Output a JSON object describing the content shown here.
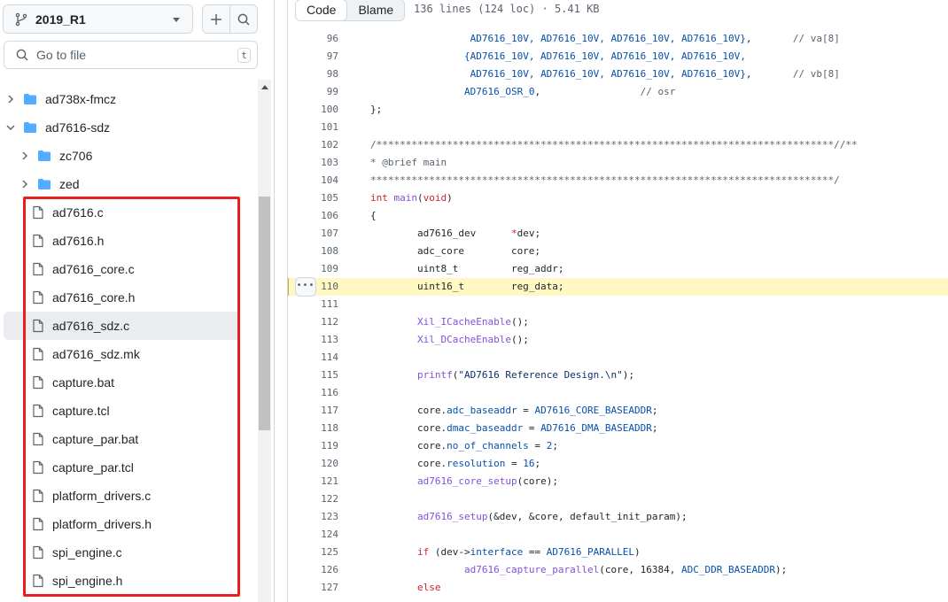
{
  "sidebar": {
    "branch": "2019_R1",
    "search_placeholder": "Go to file",
    "search_shortcut": "t",
    "tree": [
      {
        "label": "ad738x-fmcz",
        "type": "folder",
        "level": 0,
        "expanded": false
      },
      {
        "label": "ad7616-sdz",
        "type": "folder",
        "level": 0,
        "expanded": true
      },
      {
        "label": "zc706",
        "type": "folder",
        "level": 1,
        "expanded": false
      },
      {
        "label": "zed",
        "type": "folder",
        "level": 1,
        "expanded": false
      },
      {
        "label": "ad7616.c",
        "type": "file",
        "level": 1
      },
      {
        "label": "ad7616.h",
        "type": "file",
        "level": 1
      },
      {
        "label": "ad7616_core.c",
        "type": "file",
        "level": 1
      },
      {
        "label": "ad7616_core.h",
        "type": "file",
        "level": 1
      },
      {
        "label": "ad7616_sdz.c",
        "type": "file",
        "level": 1,
        "selected": true
      },
      {
        "label": "ad7616_sdz.mk",
        "type": "file",
        "level": 1
      },
      {
        "label": "capture.bat",
        "type": "file",
        "level": 1
      },
      {
        "label": "capture.tcl",
        "type": "file",
        "level": 1
      },
      {
        "label": "capture_par.bat",
        "type": "file",
        "level": 1
      },
      {
        "label": "capture_par.tcl",
        "type": "file",
        "level": 1
      },
      {
        "label": "platform_drivers.c",
        "type": "file",
        "level": 1
      },
      {
        "label": "platform_drivers.h",
        "type": "file",
        "level": 1
      },
      {
        "label": "spi_engine.c",
        "type": "file",
        "level": 1
      },
      {
        "label": "spi_engine.h",
        "type": "file",
        "level": 1
      }
    ]
  },
  "viewer": {
    "code_tab": "Code",
    "blame_tab": "Blame",
    "file_meta": "136 lines (124 loc) · 5.41 KB",
    "highlighted_line": "110",
    "lines": [
      {
        "num": "96",
        "tokens": [
          [
            "                 ",
            ""
          ],
          [
            "AD7616_10V, AD7616_10V, AD7616_10V, AD7616_10V}",
            "blue"
          ],
          [
            ",       ",
            ""
          ],
          [
            "// va[8]",
            "gray"
          ]
        ]
      },
      {
        "num": "97",
        "tokens": [
          [
            "                ",
            ""
          ],
          [
            "{AD7616_10V, AD7616_10V, AD7616_10V, AD7616_10V,",
            "blue"
          ]
        ]
      },
      {
        "num": "98",
        "tokens": [
          [
            "                 ",
            ""
          ],
          [
            "AD7616_10V, AD7616_10V, AD7616_10V, AD7616_10V}",
            "blue"
          ],
          [
            ",       ",
            ""
          ],
          [
            "// vb[8]",
            "gray"
          ]
        ]
      },
      {
        "num": "99",
        "tokens": [
          [
            "                ",
            ""
          ],
          [
            "AD7616_OSR_0",
            "blue"
          ],
          [
            ",                 ",
            ""
          ],
          [
            "// osr",
            "gray"
          ]
        ]
      },
      {
        "num": "100",
        "tokens": [
          [
            "};",
            ""
          ]
        ]
      },
      {
        "num": "101",
        "tokens": []
      },
      {
        "num": "102",
        "tokens": [
          [
            "/******************************************************************************//**",
            "gray"
          ]
        ]
      },
      {
        "num": "103",
        "tokens": [
          [
            "* @brief main",
            "gray"
          ]
        ]
      },
      {
        "num": "104",
        "tokens": [
          [
            "*******************************************************************************/",
            "gray"
          ]
        ]
      },
      {
        "num": "105",
        "tokens": [
          [
            "int",
            "red"
          ],
          [
            " ",
            ""
          ],
          [
            "main",
            "purple"
          ],
          [
            "(",
            ""
          ],
          [
            "void",
            "red"
          ],
          [
            ")",
            ""
          ]
        ]
      },
      {
        "num": "106",
        "tokens": [
          [
            "{",
            ""
          ]
        ]
      },
      {
        "num": "107",
        "tokens": [
          [
            "        ad7616_dev      ",
            ""
          ],
          [
            "*",
            "red"
          ],
          [
            "dev;",
            ""
          ]
        ]
      },
      {
        "num": "108",
        "tokens": [
          [
            "        adc_core        core;",
            ""
          ]
        ]
      },
      {
        "num": "109",
        "tokens": [
          [
            "        uint8_t         reg_addr;",
            ""
          ]
        ]
      },
      {
        "num": "110",
        "tokens": [
          [
            "        uint16_t        reg_data;",
            ""
          ]
        ]
      },
      {
        "num": "111",
        "tokens": []
      },
      {
        "num": "112",
        "tokens": [
          [
            "        ",
            ""
          ],
          [
            "Xil_ICacheEnable",
            "purple"
          ],
          [
            "();",
            ""
          ]
        ]
      },
      {
        "num": "113",
        "tokens": [
          [
            "        ",
            ""
          ],
          [
            "Xil_DCacheEnable",
            "purple"
          ],
          [
            "();",
            ""
          ]
        ]
      },
      {
        "num": "114",
        "tokens": []
      },
      {
        "num": "115",
        "tokens": [
          [
            "        ",
            ""
          ],
          [
            "printf",
            "purple"
          ],
          [
            "(",
            ""
          ],
          [
            "\"AD7616 Reference Design.\\n\"",
            "navy"
          ],
          [
            ");",
            ""
          ]
        ]
      },
      {
        "num": "116",
        "tokens": []
      },
      {
        "num": "117",
        "tokens": [
          [
            "        core.",
            ""
          ],
          [
            "adc_baseaddr",
            "blue"
          ],
          [
            " = ",
            ""
          ],
          [
            "AD7616_CORE_BASEADDR",
            "blue"
          ],
          [
            ";",
            ""
          ]
        ]
      },
      {
        "num": "118",
        "tokens": [
          [
            "        core.",
            ""
          ],
          [
            "dmac_baseaddr",
            "blue"
          ],
          [
            " = ",
            ""
          ],
          [
            "AD7616_DMA_BASEADDR",
            "blue"
          ],
          [
            ";",
            ""
          ]
        ]
      },
      {
        "num": "119",
        "tokens": [
          [
            "        core.",
            ""
          ],
          [
            "no_of_channels",
            "blue"
          ],
          [
            " = ",
            ""
          ],
          [
            "2",
            "blue"
          ],
          [
            ";",
            ""
          ]
        ]
      },
      {
        "num": "120",
        "tokens": [
          [
            "        core.",
            ""
          ],
          [
            "resolution",
            "blue"
          ],
          [
            " = ",
            ""
          ],
          [
            "16",
            "blue"
          ],
          [
            ";",
            ""
          ]
        ]
      },
      {
        "num": "121",
        "tokens": [
          [
            "        ",
            ""
          ],
          [
            "ad7616_core_setup",
            "purple"
          ],
          [
            "(core);",
            ""
          ]
        ]
      },
      {
        "num": "122",
        "tokens": []
      },
      {
        "num": "123",
        "tokens": [
          [
            "        ",
            ""
          ],
          [
            "ad7616_setup",
            "purple"
          ],
          [
            "(&dev, &core, default_init_param);",
            ""
          ]
        ]
      },
      {
        "num": "124",
        "tokens": []
      },
      {
        "num": "125",
        "tokens": [
          [
            "        ",
            ""
          ],
          [
            "if",
            "red"
          ],
          [
            " (dev->",
            ""
          ],
          [
            "interface",
            "blue"
          ],
          [
            " == ",
            ""
          ],
          [
            "AD7616_PARALLEL",
            "blue"
          ],
          [
            ")",
            ""
          ]
        ]
      },
      {
        "num": "126",
        "tokens": [
          [
            "                ",
            ""
          ],
          [
            "ad7616_capture_parallel",
            "purple"
          ],
          [
            "(core, 16384, ",
            ""
          ],
          [
            "ADC_DDR_BASEADDR",
            "blue"
          ],
          [
            ");",
            ""
          ]
        ]
      },
      {
        "num": "127",
        "tokens": [
          [
            "        ",
            ""
          ],
          [
            "else",
            "red"
          ]
        ]
      }
    ]
  },
  "colors": {
    "accent_folder": "#54aeff",
    "highlight_line_bg": "#fff8c5",
    "annotation_box": "#e81f1f"
  }
}
